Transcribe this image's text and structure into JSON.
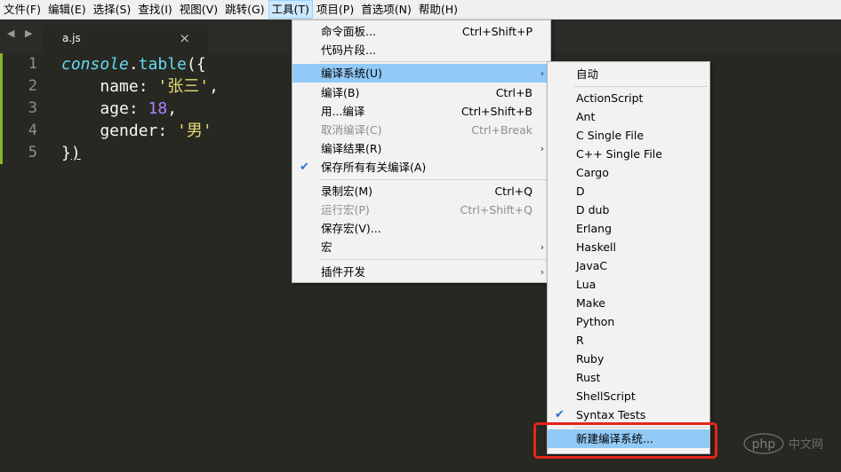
{
  "menubar": [
    "文件(F)",
    "编辑(E)",
    "选择(S)",
    "查找(I)",
    "视图(V)",
    "跳转(G)",
    "工具(T)",
    "项目(P)",
    "首选项(N)",
    "帮助(H)"
  ],
  "tab": {
    "title": "a.js",
    "close_glyph": "×",
    "nav_glyph": "◀ ▶"
  },
  "editor": {
    "line_numbers": [
      "1",
      "2",
      "3",
      "4",
      "5"
    ],
    "lines": {
      "l1": {
        "obj": "console",
        "dot": ".",
        "fn": "table",
        "rest": "({"
      },
      "l2": {
        "key": "    name: ",
        "str": "'张三'",
        "rest": ","
      },
      "l3": {
        "key": "    age: ",
        "num": "18",
        "rest": ","
      },
      "l4": {
        "key": "    gender: ",
        "str": "'男'"
      },
      "l5": {
        "a": "}",
        "b": ")"
      }
    }
  },
  "tools_menu": [
    {
      "label": "命令面板...",
      "shortcut": "Ctrl+Shift+P"
    },
    {
      "label": "代码片段..."
    },
    {
      "label": "编译系统(U)",
      "submenu": true,
      "highlighted": true
    },
    {
      "label": "编译(B)",
      "shortcut": "Ctrl+B"
    },
    {
      "label": "用...编译",
      "shortcut": "Ctrl+Shift+B"
    },
    {
      "label": "取消编译(C)",
      "shortcut": "Ctrl+Break",
      "disabled": true
    },
    {
      "label": "编译结果(R)",
      "submenu": true
    },
    {
      "label": "保存所有有关编译(A)",
      "checked": true
    },
    {
      "label": "录制宏(M)",
      "shortcut": "Ctrl+Q"
    },
    {
      "label": "运行宏(P)",
      "shortcut": "Ctrl+Shift+Q",
      "disabled": true
    },
    {
      "label": "保存宏(V)..."
    },
    {
      "label": "宏",
      "submenu": true
    },
    {
      "label": "插件开发",
      "submenu": true
    }
  ],
  "build_system_menu": [
    {
      "label": "自动"
    },
    {
      "label": "ActionScript"
    },
    {
      "label": "Ant"
    },
    {
      "label": "C Single File"
    },
    {
      "label": "C++ Single File"
    },
    {
      "label": "Cargo"
    },
    {
      "label": "D"
    },
    {
      "label": "D dub"
    },
    {
      "label": "Erlang"
    },
    {
      "label": "Haskell"
    },
    {
      "label": "JavaC"
    },
    {
      "label": "Lua"
    },
    {
      "label": "Make"
    },
    {
      "label": "Python"
    },
    {
      "label": "R"
    },
    {
      "label": "Ruby"
    },
    {
      "label": "Rust"
    },
    {
      "label": "ShellScript"
    },
    {
      "label": "Syntax Tests",
      "checked": true
    },
    {
      "label": "新建编译系统...",
      "highlighted": true
    }
  ],
  "glyphs": {
    "check": "✔",
    "arrow": "›"
  },
  "watermark_text": "php中文网",
  "colors": {
    "editor_bg": "#272822",
    "highlight": "#91c9f7",
    "annotation": "#e6241b",
    "gutter_mark": "#a6e22e"
  }
}
